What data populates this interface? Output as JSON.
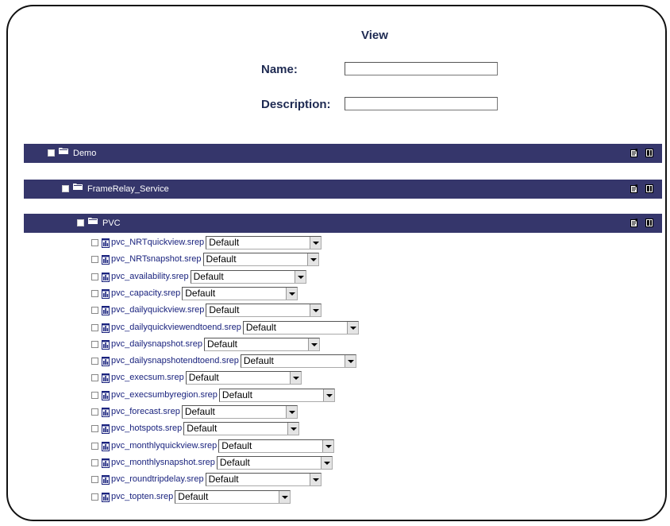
{
  "form": {
    "title": "View",
    "name_label": "Name:",
    "name_value": "",
    "description_label": "Description:",
    "description_value": ""
  },
  "tree": [
    {
      "name": "Demo",
      "icon": "folder-icon",
      "actions": [
        "edit-icon",
        "copy-icon"
      ]
    },
    {
      "name": "FrameRelay_Service",
      "icon": "folder-icon",
      "actions": [
        "edit-icon",
        "copy-icon"
      ]
    },
    {
      "name": "PVC",
      "icon": "folder-icon",
      "actions": [
        "edit-icon",
        "copy-icon"
      ]
    }
  ],
  "reports": [
    {
      "name": "pvc_NRTquickview.srep",
      "selected": "Default"
    },
    {
      "name": "pvc_NRTsnapshot.srep",
      "selected": "Default"
    },
    {
      "name": "pvc_availability.srep",
      "selected": "Default"
    },
    {
      "name": "pvc_capacity.srep",
      "selected": "Default"
    },
    {
      "name": "pvc_dailyquickview.srep",
      "selected": "Default"
    },
    {
      "name": "pvc_dailyquickviewendtoend.srep",
      "selected": "Default"
    },
    {
      "name": "pvc_dailysnapshot.srep",
      "selected": "Default"
    },
    {
      "name": "pvc_dailysnapshotendtoend.srep",
      "selected": "Default"
    },
    {
      "name": "pvc_execsum.srep",
      "selected": "Default"
    },
    {
      "name": "pvc_execsumbyregion.srep",
      "selected": "Default"
    },
    {
      "name": "pvc_forecast.srep",
      "selected": "Default"
    },
    {
      "name": "pvc_hotspots.srep",
      "selected": "Default"
    },
    {
      "name": "pvc_monthlyquickview.srep",
      "selected": "Default"
    },
    {
      "name": "pvc_monthlysnapshot.srep",
      "selected": "Default"
    },
    {
      "name": "pvc_roundtripdelay.srep",
      "selected": "Default"
    },
    {
      "name": "pvc_topten.srep",
      "selected": "Default"
    }
  ],
  "colors": {
    "bar": "#35366b",
    "label": "#1e2a52",
    "link": "#1a237e"
  }
}
